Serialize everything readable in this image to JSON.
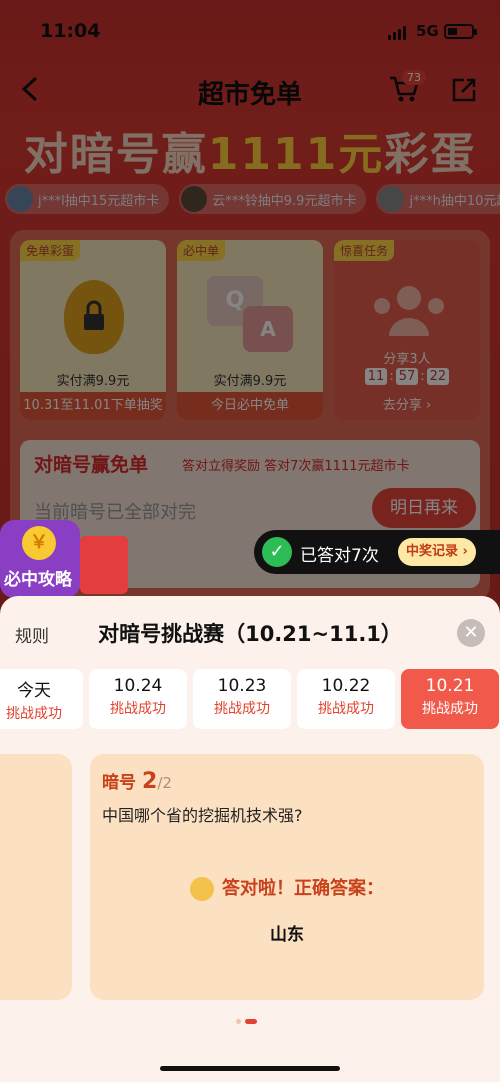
{
  "status": {
    "time": "11:04",
    "network": "5G"
  },
  "nav": {
    "title": "超市免单",
    "cart_count": "73"
  },
  "banner": {
    "title_pre": "对暗号赢",
    "title_num": "1111元",
    "title_post": "彩蛋"
  },
  "ticker": [
    {
      "text": "j***l抽中15元超市卡"
    },
    {
      "text": "云***铃抽中9.9元超市卡"
    },
    {
      "text": "j***h抽中10元超"
    }
  ],
  "tasks": [
    {
      "tag": "免单彩蛋",
      "sub": "实付满9.9元",
      "foot": "10.31至11.01下单抽奖"
    },
    {
      "tag": "必中单",
      "sub": "实付满9.9元",
      "foot": "今日必中免单",
      "q": "Q",
      "a": "A"
    },
    {
      "tag": "惊喜任务",
      "share": "分享3人",
      "timer": [
        "11",
        "57",
        "22"
      ],
      "foot": "去分享 ›"
    }
  ],
  "darkbox": {
    "heading": "对暗号赢免单",
    "subheading": "答对立得奖励 答对7次赢1111元超市卡",
    "current": "当前暗号已全部对完",
    "button": "明日再来"
  },
  "guide": {
    "label": "必中攻略",
    "coin": "￥"
  },
  "toast": {
    "text": "已答对7次",
    "record": "中奖记录 ›"
  },
  "sheet": {
    "rules": "规则",
    "title": "对暗号挑战赛（10.21~11.1）",
    "dates": [
      {
        "date": "今天",
        "status": "挑战成功"
      },
      {
        "date": "10.24",
        "status": "挑战成功"
      },
      {
        "date": "10.23",
        "status": "挑战成功"
      },
      {
        "date": "10.22",
        "status": "挑战成功"
      },
      {
        "date": "10.21",
        "status": "挑战成功"
      }
    ],
    "question": {
      "label": "暗号",
      "index": "2",
      "total": "/2",
      "text": "中国哪个省的挖掘机技术强?",
      "result": "答对啦！正确答案：",
      "answer": "山东"
    }
  },
  "colors": {
    "accent": "#e8433c",
    "active_date": "#f15a4b",
    "success": "#2dbd56"
  }
}
